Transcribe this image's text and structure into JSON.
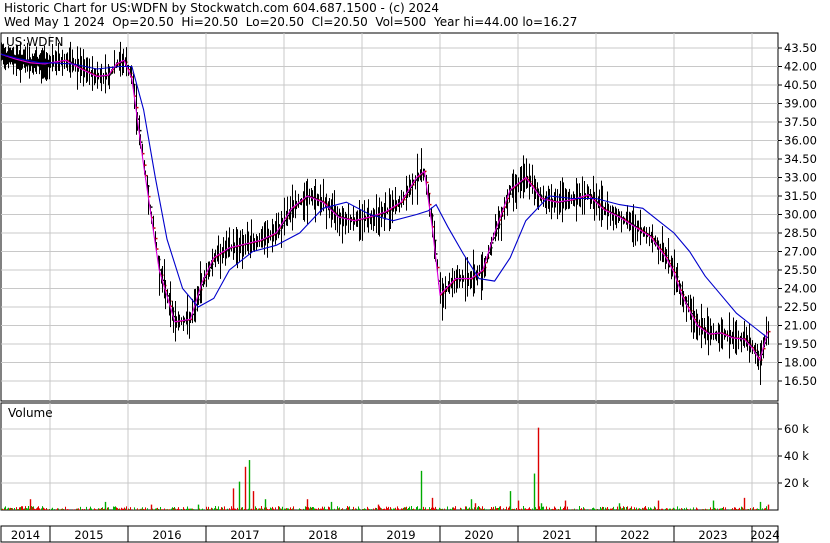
{
  "header": {
    "title": "Historic Chart for US:WDFN by Stockwatch.com 604.687.1500 - (c) 2024",
    "date": "Wed May  1 2024",
    "open": "Op=20.50",
    "high": "Hi=20.50",
    "low": "Lo=20.50",
    "close": "Cl=20.50",
    "volume": "Vol=500",
    "year_range": "Year hi=44.00  lo=16.27"
  },
  "price_panel": {
    "label": "US:WDFN"
  },
  "volume_panel": {
    "label": "Volume"
  },
  "colors": {
    "price_bar": "#000000",
    "price_down": "#cc0000",
    "ma_short": "#e000e0",
    "ma_long": "#0000cc",
    "vol_up": "#00aa00",
    "vol_down": "#dd0000",
    "grid": "#c8c8c8"
  },
  "chart_data": [
    {
      "type": "line",
      "title": "US:WDFN",
      "y_ticks": [
        "43.50",
        "42.00",
        "40.50",
        "39.00",
        "37.50",
        "36.00",
        "34.50",
        "33.00",
        "31.50",
        "30.00",
        "28.50",
        "27.00",
        "25.50",
        "24.00",
        "22.50",
        "21.00",
        "19.50",
        "18.00",
        "16.50"
      ],
      "ylim": [
        15.5,
        44.5
      ],
      "x_years": [
        "2014",
        "2015",
        "2016",
        "2017",
        "2018",
        "2019",
        "2020",
        "2021",
        "2022",
        "2023",
        "2024"
      ],
      "series": [
        {
          "x": [
            2014.0,
            2014.3,
            2014.6,
            2014.9,
            2015.0,
            2015.2,
            2015.4,
            2015.6,
            2015.75,
            2015.85,
            2015.95,
            2016.05,
            2016.2,
            2016.4,
            2016.6,
            2016.8,
            2016.95,
            2017.1,
            2017.3,
            2017.5,
            2017.7,
            2017.9,
            2018.1,
            2018.3,
            2018.5,
            2018.7,
            2018.9,
            2019.1,
            2019.3,
            2019.5,
            2019.6,
            2019.7,
            2019.8,
            2019.9,
            2020.0,
            2020.2,
            2020.4,
            2020.55,
            2020.7,
            2020.9,
            2021.1,
            2021.3,
            2021.5,
            2021.7,
            2021.9,
            2022.1,
            2022.3,
            2022.5,
            2022.7,
            2022.9,
            2023.0,
            2023.1,
            2023.2,
            2023.3,
            2023.45,
            2023.6,
            2023.75,
            2023.9,
            2024.0,
            2024.1,
            2024.2
          ],
          "values": [
            43.0,
            42.6,
            42.3,
            42.2,
            42.3,
            42.5,
            41.8,
            41.2,
            41.3,
            42.2,
            42.5,
            41.0,
            34.0,
            25.5,
            21.3,
            21.5,
            24.5,
            26.5,
            27.3,
            27.6,
            27.9,
            28.5,
            30.5,
            31.5,
            31.0,
            29.8,
            29.5,
            29.8,
            30.2,
            31.0,
            32.0,
            33.0,
            33.5,
            29.0,
            23.5,
            24.8,
            24.8,
            25.5,
            28.5,
            32.0,
            33.0,
            31.3,
            31.0,
            31.2,
            31.6,
            30.4,
            29.8,
            29.0,
            28.2,
            26.5,
            25.3,
            23.5,
            22.2,
            21.0,
            20.3,
            20.4,
            20.0,
            19.9,
            19.2,
            18.2,
            20.5
          ]
        },
        {
          "x": [
            2014.0,
            2014.4,
            2014.8,
            2015.0,
            2015.3,
            2015.6,
            2015.9,
            2016.05,
            2016.2,
            2016.35,
            2016.5,
            2016.7,
            2016.9,
            2017.1,
            2017.3,
            2017.6,
            2017.9,
            2018.2,
            2018.5,
            2018.8,
            2019.1,
            2019.4,
            2019.7,
            2019.85,
            2019.95,
            2020.1,
            2020.3,
            2020.5,
            2020.7,
            2020.9,
            2021.1,
            2021.4,
            2021.7,
            2022.0,
            2022.3,
            2022.6,
            2022.8,
            2023.0,
            2023.2,
            2023.4,
            2023.6,
            2023.8,
            2024.0,
            2024.2
          ],
          "values": [
            43.0,
            42.6,
            42.3,
            42.3,
            42.2,
            41.8,
            42.0,
            42.0,
            38.5,
            33.0,
            28.0,
            24.0,
            22.5,
            23.2,
            25.5,
            27.0,
            27.5,
            28.5,
            30.5,
            31.0,
            30.0,
            29.5,
            30.0,
            30.3,
            30.8,
            29.0,
            26.8,
            24.8,
            24.6,
            26.5,
            29.5,
            31.5,
            31.3,
            31.3,
            30.8,
            30.5,
            29.5,
            28.5,
            27.0,
            25.0,
            23.5,
            22.0,
            21.0,
            20.0
          ]
        }
      ]
    },
    {
      "type": "bar",
      "title": "Volume",
      "y_ticks": [
        "60 k",
        "40 k",
        "20 k"
      ],
      "ylim": [
        0,
        70
      ],
      "units": "k",
      "x_years": [
        "2014",
        "2015",
        "2016",
        "2017",
        "2018",
        "2019",
        "2020",
        "2021",
        "2022",
        "2023",
        "2024"
      ],
      "series": [
        {
          "x": [
            2014.6,
            2015.7,
            2016.3,
            2016.9,
            2017.35,
            2017.42,
            2017.5,
            2017.55,
            2017.6,
            2017.75,
            2018.3,
            2018.6,
            2019.2,
            2019.75,
            2019.9,
            2020.4,
            2020.45,
            2020.9,
            2021.0,
            2021.2,
            2021.25,
            2021.3,
            2021.6,
            2022.3,
            2022.8,
            2023.5,
            2023.9,
            2024.1,
            2024.2
          ],
          "values": [
            8,
            6,
            4,
            4,
            16,
            21,
            32,
            37,
            14,
            8,
            8,
            6,
            4,
            29,
            9,
            8,
            5,
            14,
            7,
            27,
            61,
            5,
            7,
            5,
            7,
            7,
            9,
            6,
            4
          ]
        }
      ]
    }
  ]
}
